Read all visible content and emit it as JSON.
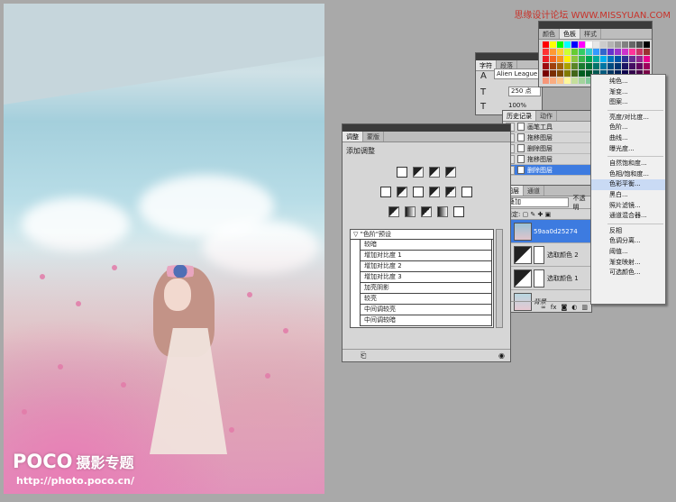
{
  "watermark": "思缘设计论坛 WWW.MISSYUAN.COM",
  "photo": {
    "logo_main": "POCO",
    "logo_sub": "摄影专题",
    "url": "http://photo.poco.cn/"
  },
  "swatches": {
    "tabs": [
      "颜色",
      "色板",
      "样式"
    ],
    "colors": [
      "#ff0000",
      "#ffff00",
      "#00ff00",
      "#00ffff",
      "#0000ff",
      "#ff00ff",
      "#ffffff",
      "#e6e6e6",
      "#cccccc",
      "#b3b3b3",
      "#999999",
      "#808080",
      "#666666",
      "#4d4d4d",
      "#000000",
      "#ff3333",
      "#ff9933",
      "#ffcc33",
      "#ccff33",
      "#66cc33",
      "#33cc66",
      "#33cccc",
      "#3399ff",
      "#3366cc",
      "#6633cc",
      "#9933cc",
      "#cc33cc",
      "#ff3399",
      "#cc3366",
      "#993333",
      "#ed1c24",
      "#f26522",
      "#f7941d",
      "#fff200",
      "#8dc63f",
      "#39b54a",
      "#00a651",
      "#00a99d",
      "#00aeef",
      "#0072bc",
      "#0054a6",
      "#2e3192",
      "#662d91",
      "#92278f",
      "#ec008c",
      "#9e0b0f",
      "#a0410d",
      "#a36209",
      "#aba000",
      "#598527",
      "#1a7b30",
      "#007236",
      "#00746b",
      "#0076a3",
      "#004a80",
      "#003471",
      "#1b1464",
      "#440e62",
      "#630460",
      "#9e005d",
      "#790000",
      "#7b2e00",
      "#7d4900",
      "#827b00",
      "#406618",
      "#005e20",
      "#005826",
      "#005952",
      "#005b7f",
      "#003663",
      "#002157",
      "#0d004c",
      "#32004b",
      "#4b0049",
      "#7b0046",
      "#f69679",
      "#f9ad81",
      "#fdc68a",
      "#fff79a",
      "#c4df9b",
      "#a3d39c",
      "#82ca9c",
      "#7accc8",
      "#6dcff6",
      "#7da7d9",
      "#8393ca",
      "#8781bd",
      "#a187be",
      "#bd8cbf",
      "#f49ac1"
    ]
  },
  "character": {
    "tabs": [
      "字符",
      "段落"
    ],
    "font": "Alien League",
    "size": "250 点",
    "leading": "100%"
  },
  "history": {
    "tabs": [
      "历史记录",
      "动作"
    ],
    "items": [
      "画笔工具",
      "拖移图层",
      "删除图层",
      "拖移图层",
      "删除图层"
    ]
  },
  "layers": {
    "tabs": [
      "图层",
      "通道"
    ],
    "blend_mode": "叠加",
    "opacity_label": "不透明",
    "lock_label": "锁定:",
    "items": [
      "59aa0d25274",
      "选取颜色 2",
      "选取颜色 1",
      "背景"
    ]
  },
  "adjustments": {
    "tabs": [
      "调整",
      "蒙版"
    ],
    "title": "添加调整",
    "presets_header": "\"色阶\"预设",
    "presets": [
      "较暗",
      "增加对比度 1",
      "增加对比度 2",
      "增加对比度 3",
      "加亮阴影",
      "较亮",
      "中间调较亮",
      "中间调较暗"
    ]
  },
  "menu": {
    "groups": [
      [
        "纯色...",
        "渐变...",
        "图案..."
      ],
      [
        "亮度/对比度...",
        "色阶...",
        "曲线...",
        "曝光度..."
      ],
      [
        "自然饱和度...",
        "色相/饱和度...",
        "色彩平衡...",
        "黑白...",
        "照片滤镜...",
        "通道混合器..."
      ],
      [
        "反相",
        "色调分离...",
        "阈值...",
        "渐变映射...",
        "可选颜色..."
      ]
    ],
    "highlighted": "色彩平衡..."
  }
}
